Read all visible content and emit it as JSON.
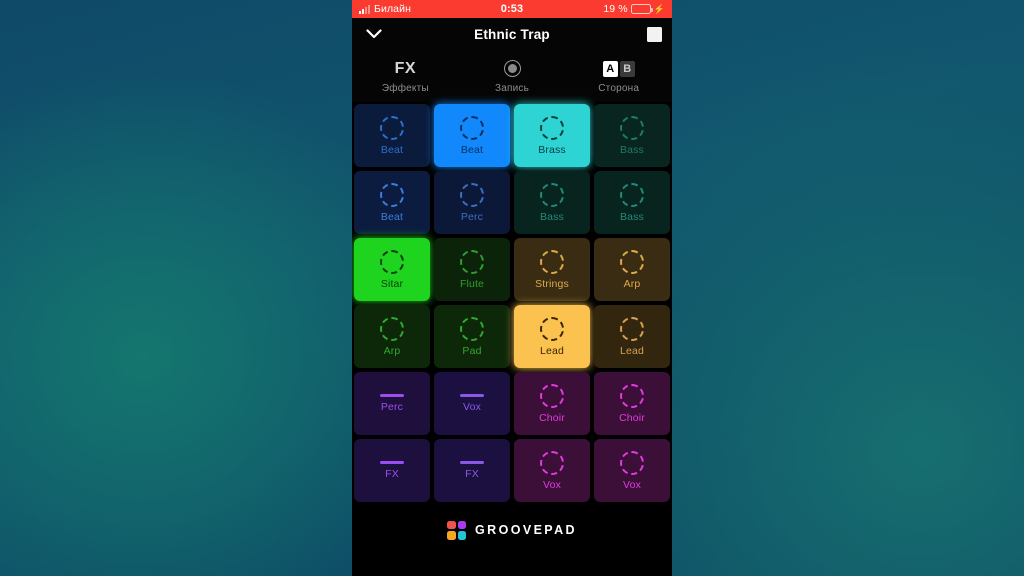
{
  "status_bar": {
    "carrier": "Билайн",
    "signal_icon": "signal-bars-icon",
    "time": "0:53",
    "battery_percent": "19 %",
    "battery_icon": "battery-icon",
    "charging_icon": "⚡",
    "background_color": "#fb3b30"
  },
  "title_bar": {
    "collapse_icon": "chevron-down-icon",
    "title": "Ethnic Trap",
    "stop_icon": "stop-square-icon"
  },
  "toolbar": {
    "fx": {
      "glyph": "FX",
      "label": "Эффекты",
      "icon": "fx-icon"
    },
    "record": {
      "label": "Запись",
      "icon": "record-circle-icon"
    },
    "side": {
      "label": "Сторона",
      "icon": "ab-toggle-icon",
      "options": [
        "A",
        "B"
      ],
      "selected": "A"
    }
  },
  "pad_grid": {
    "columns": 4,
    "rows": 6,
    "pads": [
      {
        "label": "Beat",
        "icon": "loop-ring-icon",
        "active": false,
        "bg": "#0b1b3c",
        "fg": "#2f6fd0"
      },
      {
        "label": "Beat",
        "icon": "loop-ring-icon",
        "active": true,
        "bg": "#1188fb",
        "fg": "#06305f"
      },
      {
        "label": "Brass",
        "icon": "loop-ring-icon",
        "active": true,
        "bg": "#2ed4d4",
        "fg": "#06403f"
      },
      {
        "label": "Bass",
        "icon": "loop-ring-icon",
        "active": false,
        "bg": "#09251f",
        "fg": "#1f7a6a"
      },
      {
        "label": "Beat",
        "icon": "loop-ring-icon",
        "active": false,
        "bg": "#0c1c40",
        "fg": "#3d7ddc"
      },
      {
        "label": "Perc",
        "icon": "loop-ring-icon",
        "active": false,
        "bg": "#0c1838",
        "fg": "#3a6fc4"
      },
      {
        "label": "Bass",
        "icon": "loop-ring-icon",
        "active": false,
        "bg": "#07241f",
        "fg": "#23897a"
      },
      {
        "label": "Bass",
        "icon": "loop-ring-icon",
        "active": false,
        "bg": "#07241f",
        "fg": "#23897a"
      },
      {
        "label": "Sitar",
        "icon": "loop-ring-icon",
        "active": true,
        "bg": "#1fd41f",
        "fg": "#0b3d0b"
      },
      {
        "label": "Flute",
        "icon": "loop-ring-icon",
        "active": false,
        "bg": "#0b2309",
        "fg": "#2f9e2f"
      },
      {
        "label": "Strings",
        "icon": "loop-ring-icon",
        "active": false,
        "bg": "#3a2c12",
        "fg": "#e0a94a"
      },
      {
        "label": "Arp",
        "icon": "loop-ring-icon",
        "active": false,
        "bg": "#3a2c12",
        "fg": "#e0a94a"
      },
      {
        "label": "Arp",
        "icon": "loop-ring-icon",
        "active": false,
        "bg": "#0d2709",
        "fg": "#32a832"
      },
      {
        "label": "Pad",
        "icon": "loop-ring-icon",
        "active": false,
        "bg": "#0d2709",
        "fg": "#32a832"
      },
      {
        "label": "Lead",
        "icon": "loop-ring-icon",
        "active": true,
        "bg": "#fbc250",
        "fg": "#3a2600"
      },
      {
        "label": "Lead",
        "icon": "loop-ring-icon",
        "active": false,
        "bg": "#33260f",
        "fg": "#d8a053"
      },
      {
        "label": "Perc",
        "icon": "dash-bar-icon",
        "active": false,
        "bg": "#1e0f3c",
        "fg": "#9b4df0"
      },
      {
        "label": "Vox",
        "icon": "dash-bar-icon",
        "active": false,
        "bg": "#1b1040",
        "fg": "#8a58e8"
      },
      {
        "label": "Choir",
        "icon": "loop-ring-icon",
        "active": false,
        "bg": "#3c0f38",
        "fg": "#e23ae0"
      },
      {
        "label": "Choir",
        "icon": "loop-ring-icon",
        "active": false,
        "bg": "#3c0f38",
        "fg": "#e23ae0"
      },
      {
        "label": "FX",
        "icon": "dash-bar-icon",
        "active": false,
        "bg": "#1d0f3e",
        "fg": "#9b4df0"
      },
      {
        "label": "FX",
        "icon": "dash-bar-icon",
        "active": false,
        "bg": "#1b1040",
        "fg": "#8a58e8"
      },
      {
        "label": "Vox",
        "icon": "loop-ring-icon",
        "active": false,
        "bg": "#3c0f38",
        "fg": "#e23ae0"
      },
      {
        "label": "Vox",
        "icon": "loop-ring-icon",
        "active": false,
        "bg": "#3c0f38",
        "fg": "#e23ae0"
      }
    ]
  },
  "footer": {
    "brand": "GROOVEPAD",
    "logo_icon": "grovepad-logo-icon",
    "logo_colors": [
      "#ef5350",
      "#a93af0",
      "#f5a623",
      "#22c4d8"
    ]
  }
}
